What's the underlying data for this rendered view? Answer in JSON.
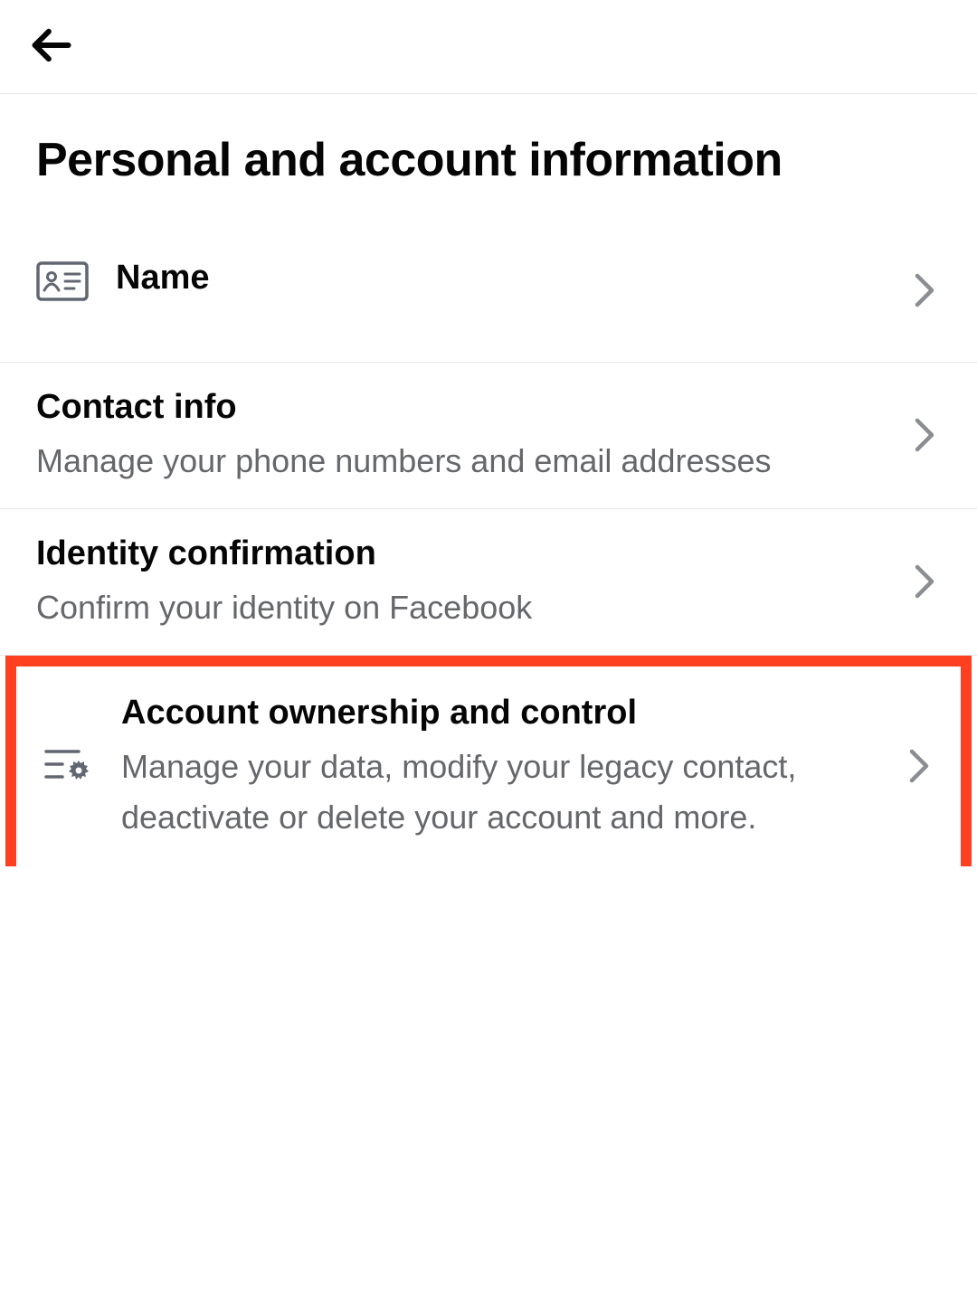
{
  "header": {
    "title": "Personal and account information"
  },
  "items": {
    "name": {
      "title": "Name"
    },
    "contact": {
      "title": "Contact info",
      "subtitle": "Manage your phone numbers and email addresses"
    },
    "identity": {
      "title": "Identity confirmation",
      "subtitle": "Confirm your identity on Facebook"
    },
    "ownership": {
      "title": "Account ownership and control",
      "subtitle": "Manage your data, modify your legacy contact, deactivate or delete your account and more."
    }
  }
}
